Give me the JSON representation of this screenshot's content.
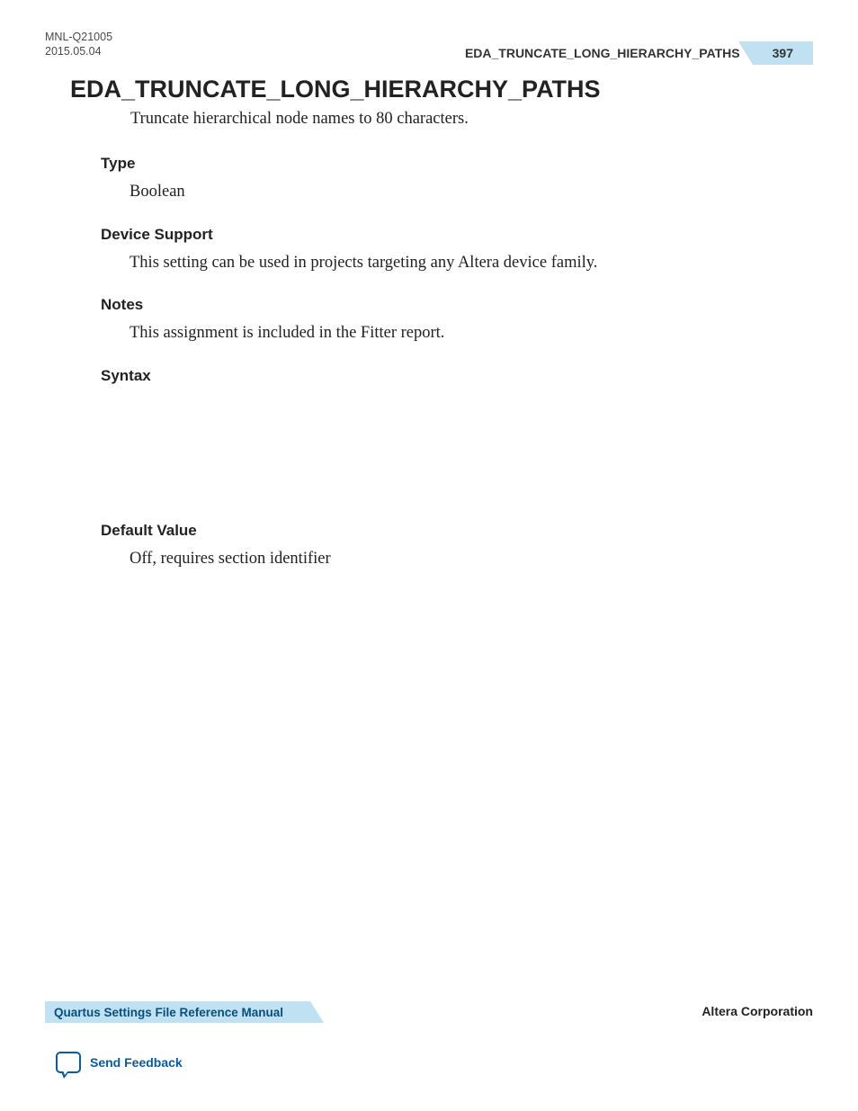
{
  "header": {
    "doc_id": "MNL-Q21005",
    "doc_date": "2015.05.04",
    "running_title": "EDA_TRUNCATE_LONG_HIERARCHY_PATHS",
    "page_number": "397"
  },
  "main": {
    "title": "EDA_TRUNCATE_LONG_HIERARCHY_PATHS",
    "description": "Truncate hierarchical node names to 80 characters.",
    "sections": {
      "type": {
        "heading": "Type",
        "body": "Boolean"
      },
      "device_support": {
        "heading": "Device Support",
        "body": "This setting can be used in projects targeting any Altera device family."
      },
      "notes": {
        "heading": "Notes",
        "body": "This assignment is included in the Fitter report."
      },
      "syntax": {
        "heading": "Syntax",
        "body": ""
      },
      "default_value": {
        "heading": "Default Value",
        "body": "Off, requires section identifier"
      }
    }
  },
  "footer": {
    "manual_name": "Quartus Settings File Reference Manual",
    "company": "Altera Corporation",
    "feedback_label": "Send Feedback"
  }
}
